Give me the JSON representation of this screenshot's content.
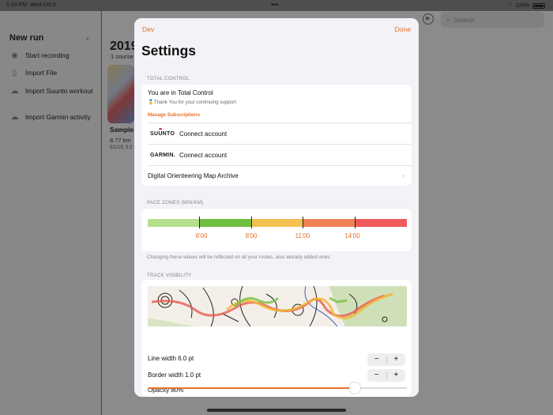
{
  "status": {
    "time": "1:24 PM",
    "date": "Wed Oct 6",
    "battery": "100%"
  },
  "sidebar": {
    "title": "New run",
    "items": [
      {
        "icon": "record-icon",
        "label": "Start recording"
      },
      {
        "icon": "file-icon",
        "label": "Import File"
      },
      {
        "icon": "cloud-download-icon",
        "label": "Import Suunto workout"
      },
      {
        "icon": "cloud-download-icon",
        "label": "Import Garmin activity"
      }
    ]
  },
  "toolbar": {
    "search_placeholder": "Search"
  },
  "main": {
    "year": "2019",
    "course_count": "1 course",
    "card": {
      "title": "Sample",
      "distance": "8.77 km",
      "date": "5/1/19, 5:2"
    }
  },
  "settings": {
    "nav_left": "Dev",
    "nav_right": "Done",
    "title": "Settings",
    "total_control": {
      "header": "TOTAL CONTROL",
      "status": "You are in Total Control",
      "thanks": "Thank You for your continuing support",
      "manage": "Manage Subscriptions",
      "suunto_brand": "SUUNTO",
      "suunto_action": "Connect account",
      "garmin_brand": "GARMIN.",
      "garmin_action": "Connect account",
      "map_archive": "Digital Orienteering Map Archive"
    },
    "pace_zones": {
      "header": "PACE ZONES (MIN/KM)",
      "segments": [
        "#b6df8e",
        "#6fbf42",
        "#f4c04f",
        "#ef8356",
        "#f05a5a"
      ],
      "labels": [
        "6'00",
        "8'00",
        "11'00",
        "14'00"
      ],
      "note": "Changing these values will be reflected on all your routes, also already added ones"
    },
    "track_visibility": {
      "header": "TRACK VISIBILITY",
      "line_width": "Line width 6.0 pt",
      "border_width": "Border width 1.0 pt",
      "opacity": "Opacity 80%",
      "opacity_value": 0.8,
      "stepper_minus": "−",
      "stepper_plus": "+"
    }
  },
  "colors": {
    "accent": "#e8702a"
  }
}
